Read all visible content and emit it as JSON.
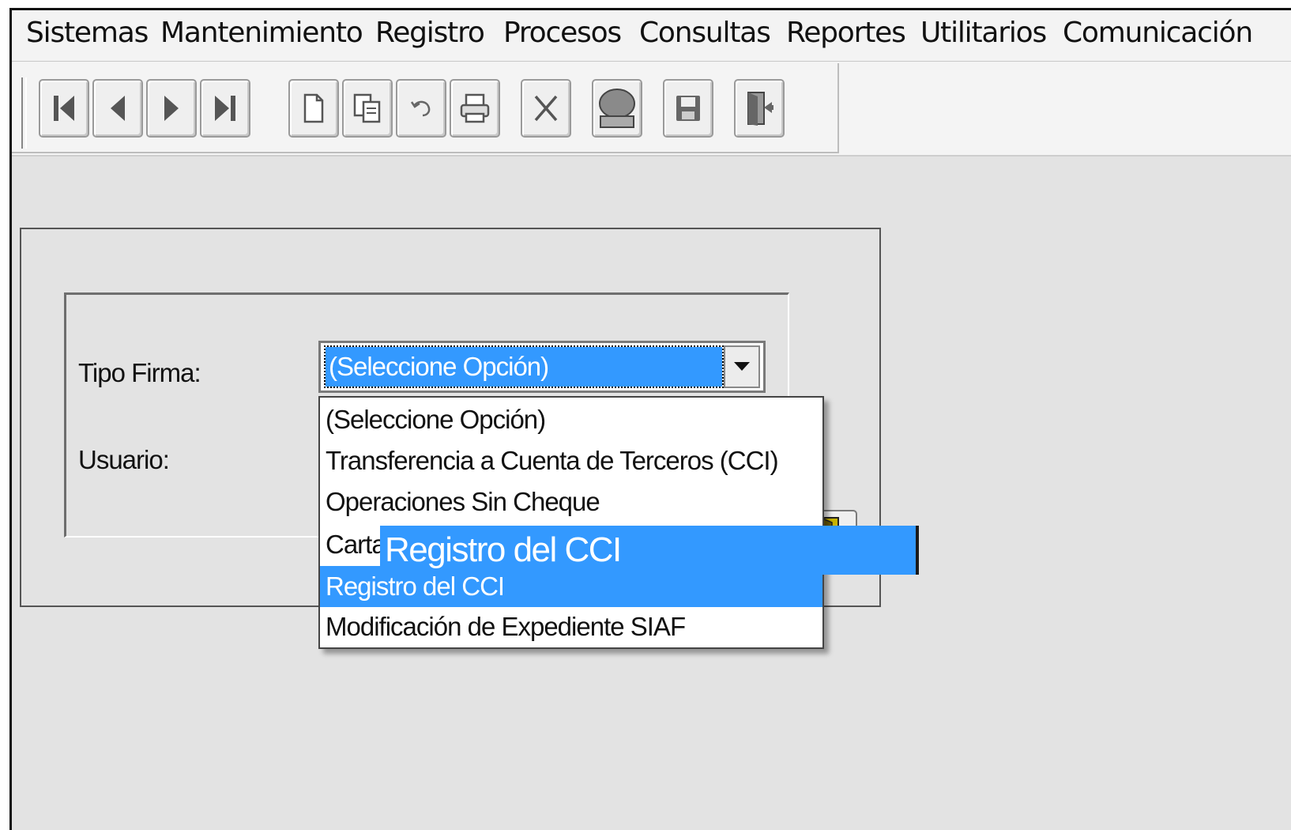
{
  "menu": {
    "items": [
      "Sistemas",
      "Mantenimiento",
      "Registro",
      "Procesos",
      "Consultas",
      "Reportes",
      "Utilitarios",
      "Comunicación"
    ]
  },
  "toolbar": {
    "buttons": [
      {
        "icon": "first-record-icon"
      },
      {
        "icon": "previous-record-icon"
      },
      {
        "icon": "next-record-icon"
      },
      {
        "icon": "last-record-icon"
      },
      {
        "icon": "new-document-icon"
      },
      {
        "icon": "copy-icon"
      },
      {
        "icon": "undo-icon"
      },
      {
        "icon": "print-icon"
      },
      {
        "icon": "delete-icon"
      },
      {
        "icon": "search-icon"
      },
      {
        "icon": "save-icon"
      },
      {
        "icon": "exit-door-icon"
      }
    ]
  },
  "form": {
    "tipo_firma_label": "Tipo Firma:",
    "usuario_label": "Usuario:",
    "tipo_firma_value": "(Seleccione Opción)",
    "options": [
      "(Seleccione Opción)",
      "Transferencia a Cuenta de Terceros (CCI)",
      "Operaciones Sin Cheque",
      "Carta",
      "Registro del CCI",
      "Modificación de Expediente SIAF"
    ],
    "selected_index": 4,
    "tooltip": "Registro del CCI"
  },
  "colors": {
    "selection": "#3399ff",
    "background": "#e3e3e3"
  }
}
